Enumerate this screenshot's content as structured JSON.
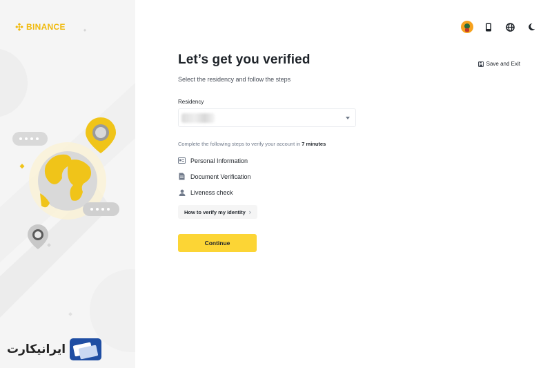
{
  "brand": {
    "name": "BINANCE",
    "color": "#f0b90b"
  },
  "header": {
    "icons": [
      "avatar",
      "mobile-icon",
      "globe-icon",
      "moon-icon"
    ],
    "save_exit_label": "Save and Exit"
  },
  "main": {
    "title": "Let’s get you verified",
    "subtitle": "Select the residency and follow the steps",
    "residency_label": "Residency",
    "residency_value": "",
    "steps_intro_prefix": "Complete the following steps to verify your account in ",
    "steps_intro_time": "7 minutes",
    "steps": [
      {
        "label": "Personal Information",
        "icon": "id-card-icon"
      },
      {
        "label": "Document Verification",
        "icon": "document-icon"
      },
      {
        "label": "Liveness check",
        "icon": "person-icon"
      }
    ],
    "how_label": "How to verify my identity",
    "continue_label": "Continue"
  },
  "watermark": {
    "text": "ایرانیکارت"
  },
  "colors": {
    "accent": "#fcd535",
    "text": "#1e2329",
    "muted": "#707a8a",
    "panel": "#f5f5f5"
  }
}
